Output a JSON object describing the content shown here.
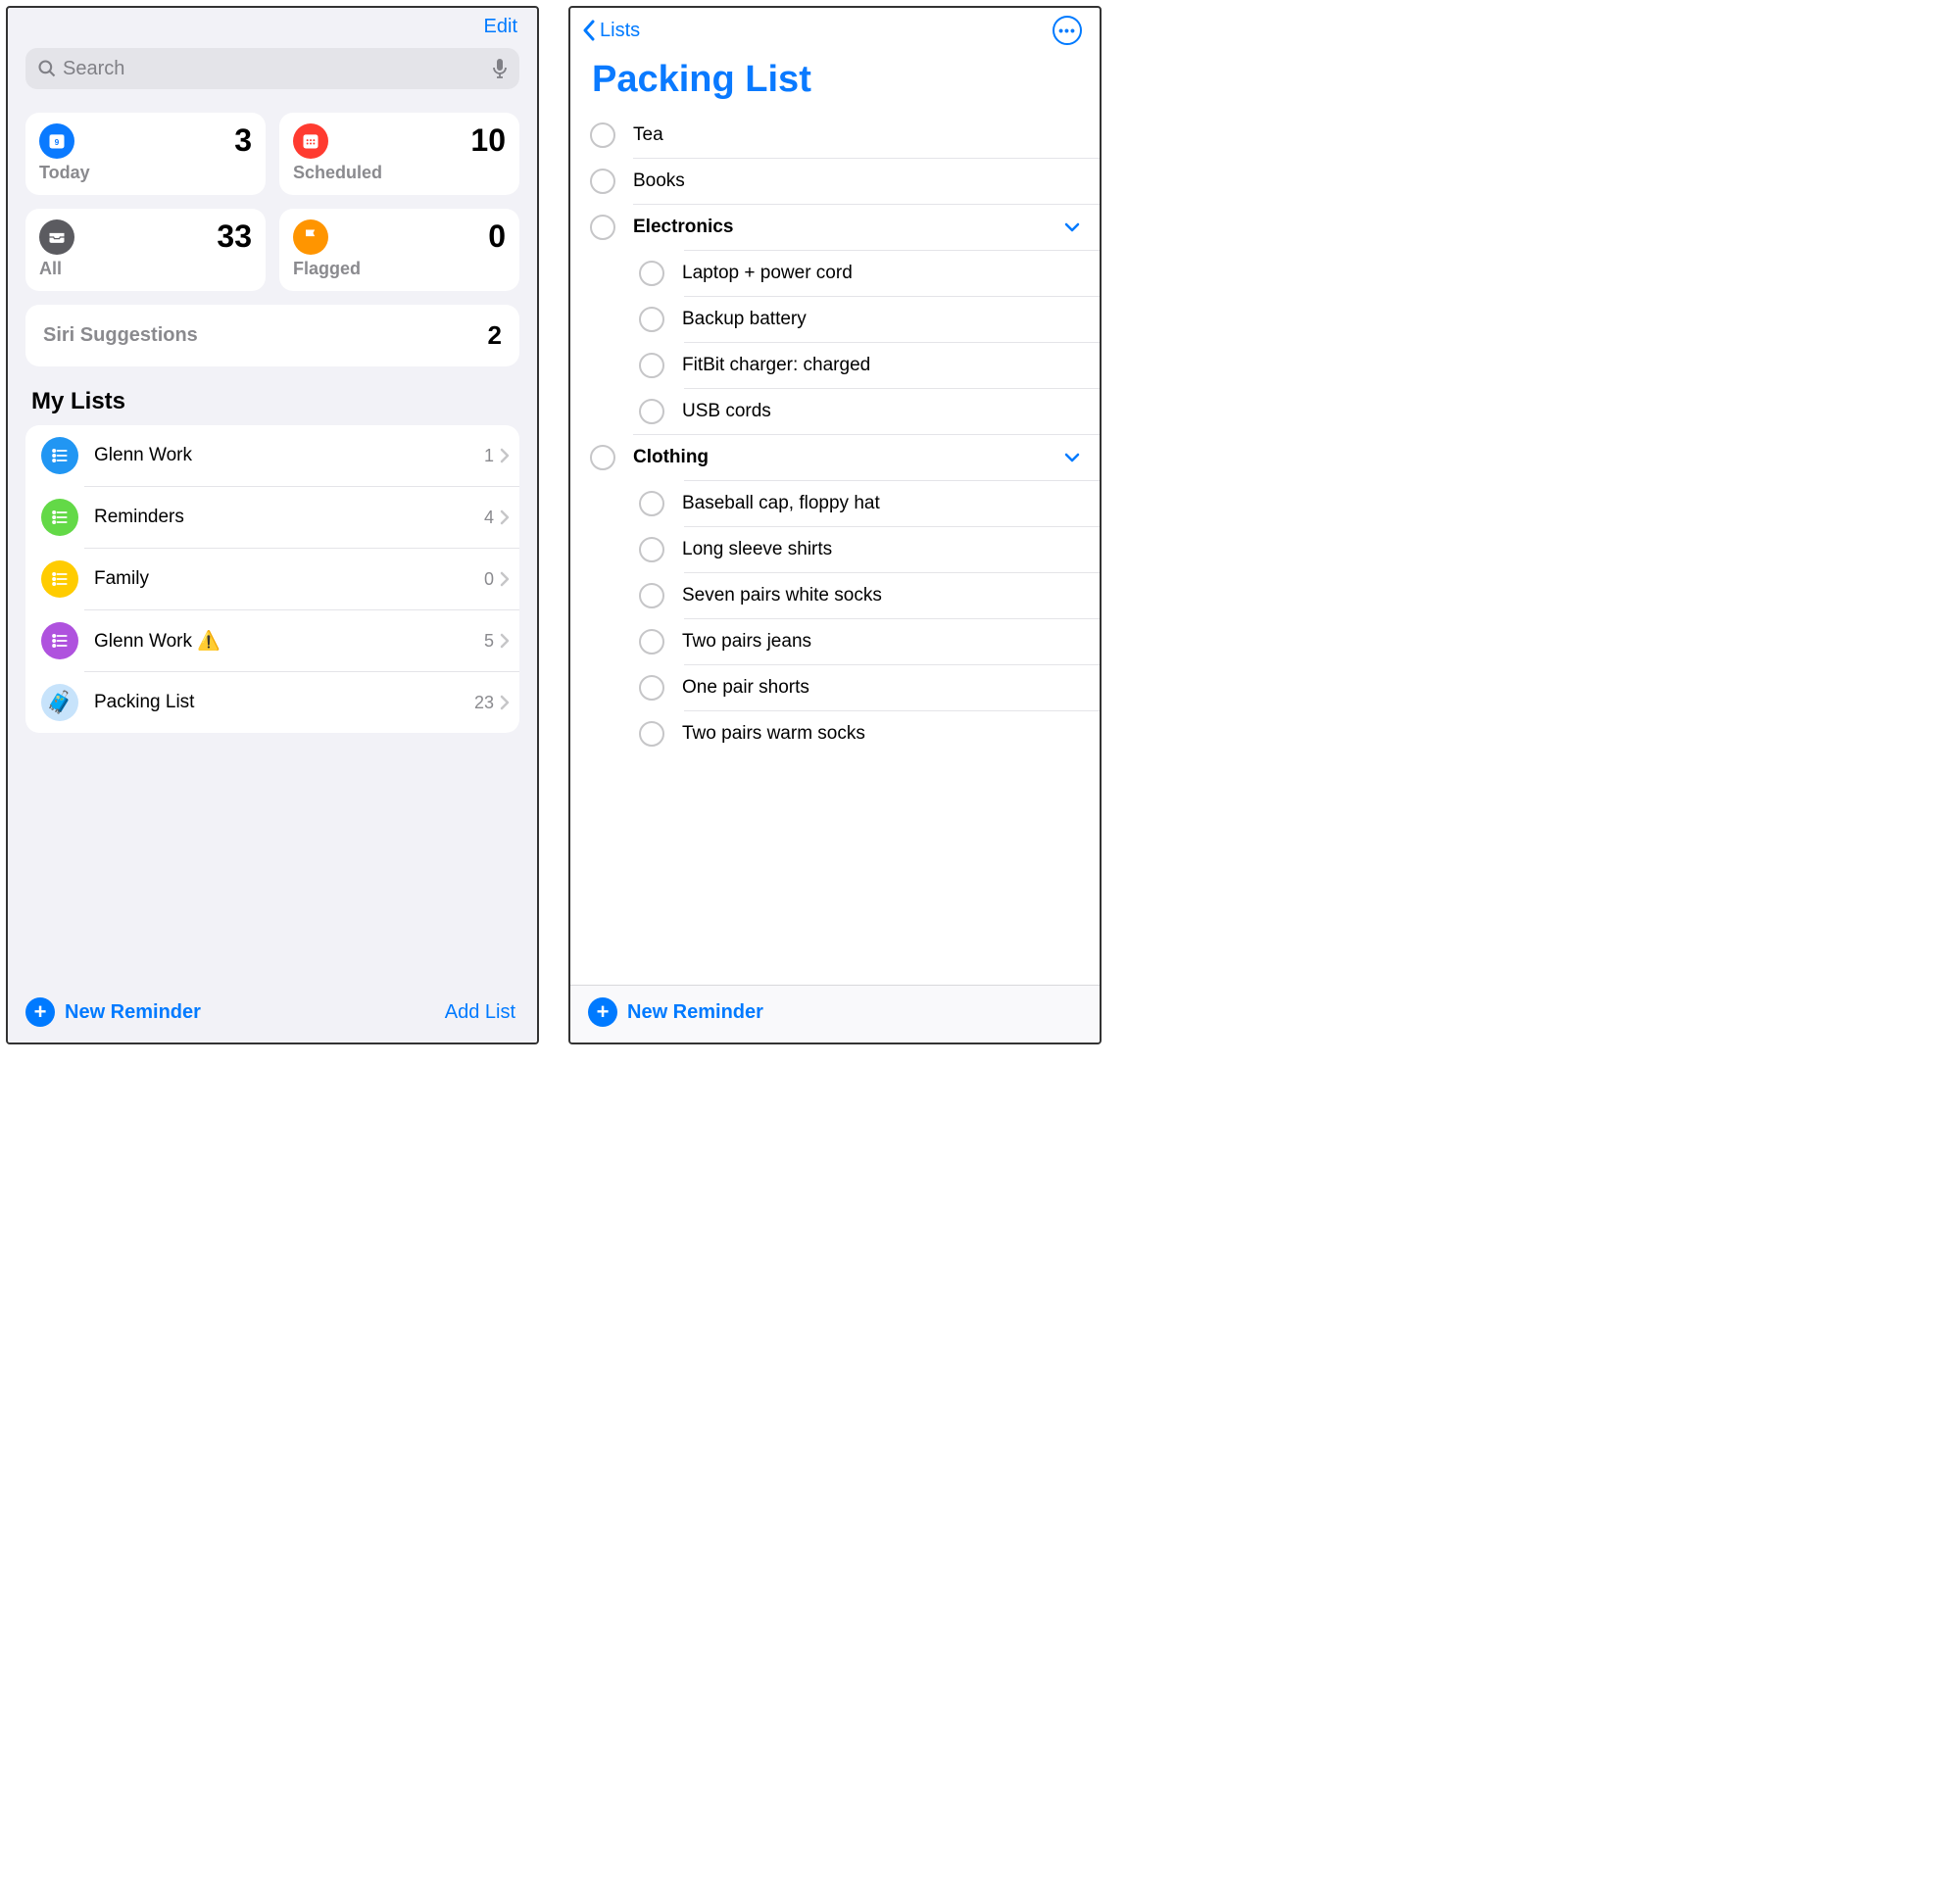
{
  "left": {
    "edit": "Edit",
    "search_placeholder": "Search",
    "cards": {
      "today": {
        "label": "Today",
        "count": "3"
      },
      "scheduled": {
        "label": "Scheduled",
        "count": "10"
      },
      "all": {
        "label": "All",
        "count": "33"
      },
      "flagged": {
        "label": "Flagged",
        "count": "0"
      }
    },
    "siri": {
      "label": "Siri Suggestions",
      "count": "2"
    },
    "my_lists_header": "My Lists",
    "lists": [
      {
        "name": "Glenn Work",
        "count": "1",
        "color": "sky",
        "icon": "list",
        "alert": false
      },
      {
        "name": "Reminders",
        "count": "4",
        "color": "lime",
        "icon": "list",
        "alert": false
      },
      {
        "name": "Family",
        "count": "0",
        "color": "amber",
        "icon": "list",
        "alert": false
      },
      {
        "name": "Glenn Work",
        "count": "5",
        "color": "purple",
        "icon": "list",
        "alert": true
      },
      {
        "name": "Packing List",
        "count": "23",
        "color": "lightblue",
        "icon": "suitcase",
        "alert": false
      }
    ],
    "new_reminder": "New Reminder",
    "add_list": "Add List"
  },
  "right": {
    "back_label": "Lists",
    "title": "Packing List",
    "items": [
      {
        "text": "Tea",
        "type": "item"
      },
      {
        "text": "Books",
        "type": "item"
      },
      {
        "text": "Electronics",
        "type": "group"
      },
      {
        "text": "Laptop + power cord",
        "type": "sub"
      },
      {
        "text": "Backup battery",
        "type": "sub"
      },
      {
        "text": "FitBit charger: charged",
        "type": "sub"
      },
      {
        "text": "USB cords",
        "type": "sub"
      },
      {
        "text": "Clothing",
        "type": "group"
      },
      {
        "text": "Baseball cap, floppy hat",
        "type": "sub"
      },
      {
        "text": "Long sleeve shirts",
        "type": "sub"
      },
      {
        "text": "Seven pairs white socks",
        "type": "sub"
      },
      {
        "text": "Two pairs jeans",
        "type": "sub"
      },
      {
        "text": "One pair shorts",
        "type": "sub"
      },
      {
        "text": "Two pairs warm socks",
        "type": "sub"
      }
    ],
    "new_reminder": "New Reminder"
  }
}
